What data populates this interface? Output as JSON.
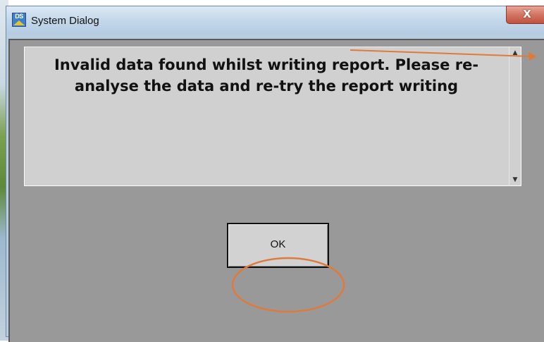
{
  "window": {
    "title": "System Dialog",
    "icon": "app-icon",
    "close_label": "X"
  },
  "dialog": {
    "message": "Invalid data found whilst writing report.  Please re-analyse the data and re-try the report writing",
    "scroll_up": "▲",
    "scroll_down": "▼",
    "ok_label": "OK"
  },
  "colors": {
    "client_background": "#999999",
    "panel_background": "#d0d0d0",
    "annotation": "#e07a3a"
  }
}
